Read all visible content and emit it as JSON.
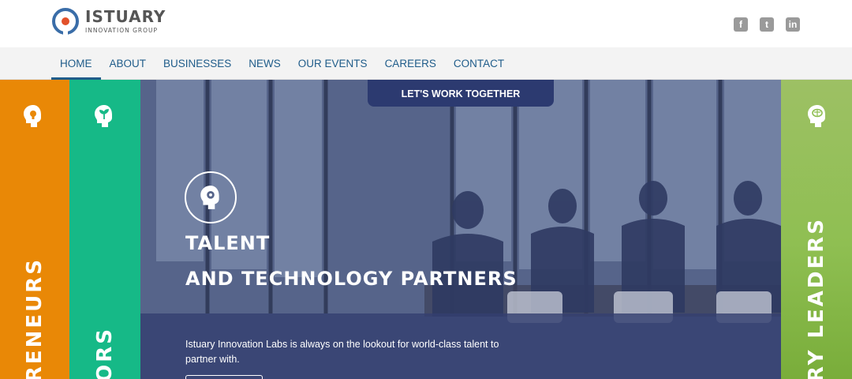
{
  "brand": {
    "name": "ISTUARY",
    "tagline": "INNOVATION GROUP",
    "colors": {
      "primary": "#3a6da8",
      "accent": "#e2512a"
    }
  },
  "social": [
    {
      "icon": "facebook-icon",
      "glyph": "f"
    },
    {
      "icon": "twitter-icon",
      "glyph": "t"
    },
    {
      "icon": "linkedin-icon",
      "glyph": "in"
    }
  ],
  "nav": {
    "items": [
      "HOME",
      "ABOUT",
      "BUSINESSES",
      "NEWS",
      "OUR EVENTS",
      "CAREERS",
      "CONTACT"
    ],
    "active": "HOME",
    "color": "#1f5c8a"
  },
  "stripes": {
    "left": {
      "label": "RENEURS",
      "color": "#e98806",
      "icon": "lightbulb-head-icon"
    },
    "middle": {
      "label": "ORS",
      "color": "#16b987",
      "icon": "seedling-head-icon"
    },
    "right": {
      "label": "RY LEADERS",
      "color": "#8fbf52",
      "icon": "brain-head-icon"
    }
  },
  "hero": {
    "cta_tab": "LET'S WORK TOGETHER",
    "title": "TALENT",
    "subtitle": "AND TECHNOLOGY PARTNERS",
    "description": "Istuary Innovation Labs is always on the lookout for world-class talent to partner with.",
    "icon": "gear-head-icon",
    "tab_color": "#2c3a70"
  }
}
